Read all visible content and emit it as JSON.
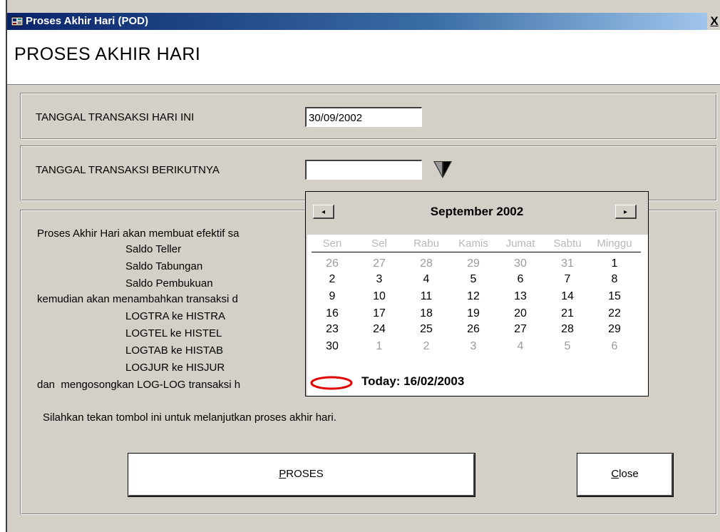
{
  "window": {
    "title": "Proses Akhir Hari (POD)",
    "close_glyph": "X"
  },
  "header": {
    "title": "PROSES AKHIR HARI"
  },
  "today_row": {
    "label": "TANGGAL TRANSAKSI HARI INI",
    "value": "30/09/2002"
  },
  "next_row": {
    "label": "TANGGAL TRANSAKSI BERIKUTNYA",
    "value": ""
  },
  "info": {
    "line1": "Proses Akhir Hari akan membuat efektif sa",
    "saldo_teller": "Saldo Teller",
    "saldo_tabungan": "Saldo Tabungan",
    "saldo_pembukuan": "Saldo Pembukuan",
    "line2": "kemudian akan menambahkan transaksi d",
    "logtra": "LOGTRA ke HISTRA",
    "logtel": "LOGTEL ke HISTEL",
    "logtab": "LOGTAB ke HISTAB",
    "logjur": "LOGJUR ke HISJUR",
    "line3": "dan  mengosongkan LOG-LOG transaksi h",
    "instruction": "Silahkan tekan tombol ini untuk melanjutkan proses akhir hari."
  },
  "buttons": {
    "proses_first": "P",
    "proses_rest": "ROSES",
    "close_first": "C",
    "close_rest": "lose"
  },
  "calendar": {
    "month_year": "September 2002",
    "prev_glyph": "◂",
    "next_glyph": "▸",
    "days_of_week": [
      "Sen",
      "Sel",
      "Rabu",
      "Kamis",
      "Jumat",
      "Sabtu",
      "Minggu"
    ],
    "weeks": [
      [
        "26",
        "27",
        "28",
        "29",
        "30",
        "31",
        "1"
      ],
      [
        "2",
        "3",
        "4",
        "5",
        "6",
        "7",
        "8"
      ],
      [
        "9",
        "10",
        "11",
        "12",
        "13",
        "14",
        "15"
      ],
      [
        "16",
        "17",
        "18",
        "19",
        "20",
        "21",
        "22"
      ],
      [
        "23",
        "24",
        "25",
        "26",
        "27",
        "28",
        "29"
      ],
      [
        "30",
        "1",
        "2",
        "3",
        "4",
        "5",
        "6"
      ]
    ],
    "selected_day": "30",
    "today_label": "Today: 16/02/2003"
  },
  "icons": {
    "app": "window-app-icon",
    "dropdown": "dropdown-arrow-icon",
    "today": "today-circle-icon"
  }
}
